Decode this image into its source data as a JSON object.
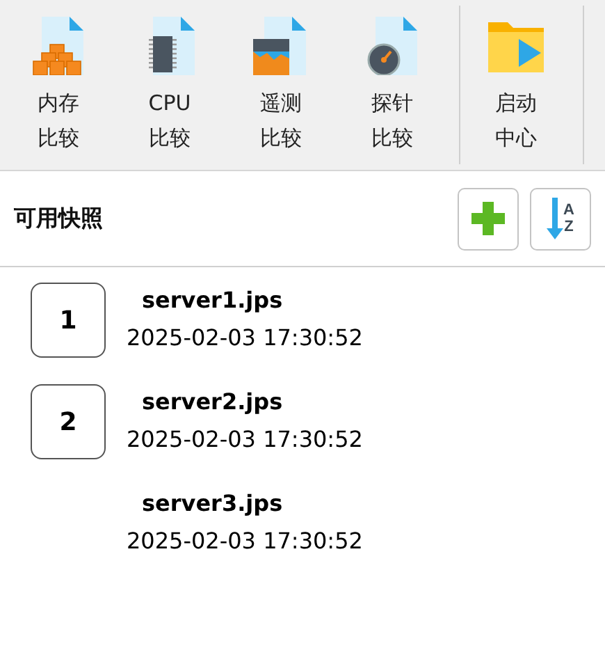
{
  "toolbar": {
    "groups": [
      [
        {
          "kind": "memory",
          "lines": [
            "内存",
            "比较"
          ]
        },
        {
          "kind": "cpu",
          "lines": [
            "CPU",
            "比较"
          ]
        },
        {
          "kind": "telemetry",
          "lines": [
            "遥测",
            "比较"
          ]
        },
        {
          "kind": "probe",
          "lines": [
            "探针",
            "比较"
          ]
        }
      ],
      [
        {
          "kind": "launch",
          "lines": [
            "启动",
            "中心"
          ]
        }
      ]
    ]
  },
  "snapshots": {
    "title": "可用快照",
    "sort_letters": [
      "A",
      "Z"
    ],
    "items": [
      {
        "number": "1",
        "name": "server1.jps",
        "time": "2025-02-03 17:30:52"
      },
      {
        "number": "2",
        "name": "server2.jps",
        "time": "2025-02-03 17:30:52"
      },
      {
        "name": "server3.jps",
        "time": "2025-02-03 17:30:52"
      }
    ]
  }
}
